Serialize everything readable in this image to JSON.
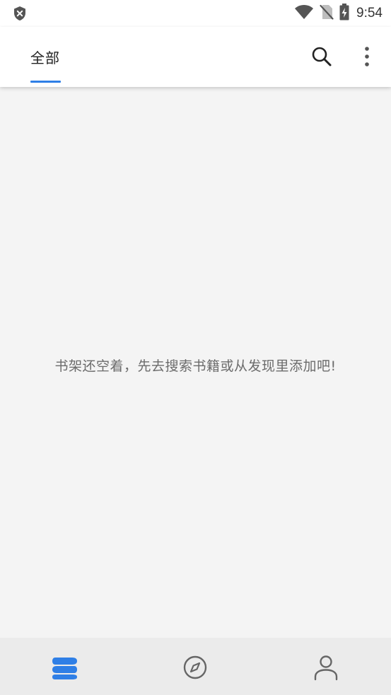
{
  "status_bar": {
    "time": "9:54",
    "icons": [
      "shield-x-icon",
      "wifi-icon",
      "no-sim-icon",
      "battery-charging-icon"
    ]
  },
  "app_bar": {
    "tab_label": "全部",
    "actions": [
      "search-icon",
      "more-vert-icon"
    ]
  },
  "colors": {
    "accent": "#2f7fe6",
    "background": "#f4f4f4",
    "bottom_nav_bg": "#ebebeb",
    "text_muted": "#6b6b6b"
  },
  "main": {
    "empty_message": "书架还空着，先去搜索书籍或从发现里添加吧!"
  },
  "bottom_nav": {
    "items": [
      {
        "icon": "bookshelf-icon",
        "active": true
      },
      {
        "icon": "compass-icon",
        "active": false
      },
      {
        "icon": "person-icon",
        "active": false
      }
    ]
  }
}
